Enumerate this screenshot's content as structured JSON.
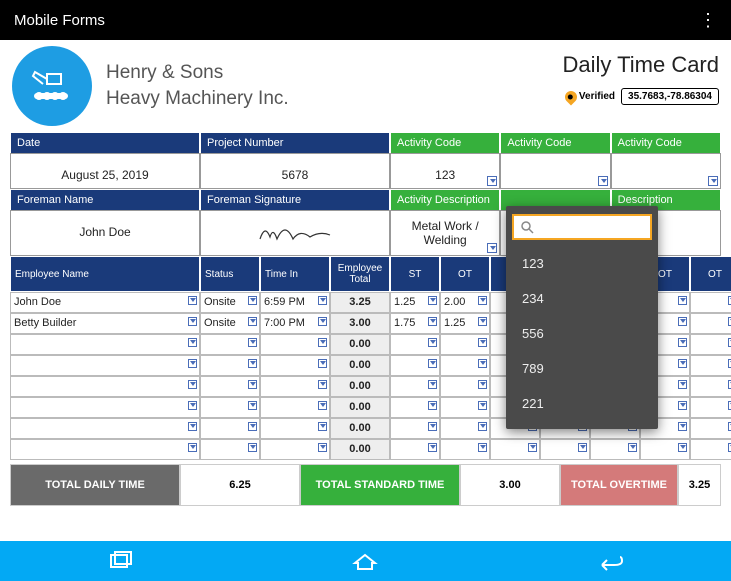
{
  "app": {
    "title": "Mobile Forms"
  },
  "company": {
    "name1": "Henry & Sons",
    "name2": "Heavy Machinery Inc."
  },
  "page_title": "Daily Time Card",
  "gps": {
    "verified": "Verified",
    "coords": "35.7683,-78.86304"
  },
  "headers": {
    "date": "Date",
    "project_number": "Project Number",
    "activity_code": "Activity Code",
    "foreman_name": "Foreman Name",
    "foreman_signature": "Foreman Signature",
    "activity_description": "Activity Description",
    "description": "Description",
    "employee_name": "Employee Name",
    "status": "Status",
    "time_in": "Time In",
    "employee_total": "Employee Total",
    "st": "ST",
    "ot": "OT"
  },
  "values": {
    "date": "August 25, 2019",
    "project_number": "5678",
    "activity_code_1": "123",
    "foreman_name": "John Doe",
    "activity_desc_1": "Metal Work / Welding"
  },
  "employees": [
    {
      "name": "John Doe",
      "status": "Onsite",
      "time_in": "6:59 PM",
      "total": "3.25",
      "st1": "1.25",
      "ot1": "2.00"
    },
    {
      "name": "Betty Builder",
      "status": "Onsite",
      "time_in": "7:00 PM",
      "total": "3.00",
      "st1": "1.75",
      "ot1": "1.25"
    }
  ],
  "empty_totals": [
    "0.00",
    "0.00",
    "0.00",
    "0.00",
    "0.00",
    "0.00"
  ],
  "totals": {
    "daily_label": "TOTAL DAILY TIME",
    "daily_value": "6.25",
    "standard_label": "TOTAL STANDARD TIME",
    "standard_value": "3.00",
    "overtime_label": "TOTAL OVERTIME",
    "overtime_value": "3.25"
  },
  "dropdown": {
    "items": [
      "123",
      "234",
      "556",
      "789",
      "221"
    ]
  }
}
